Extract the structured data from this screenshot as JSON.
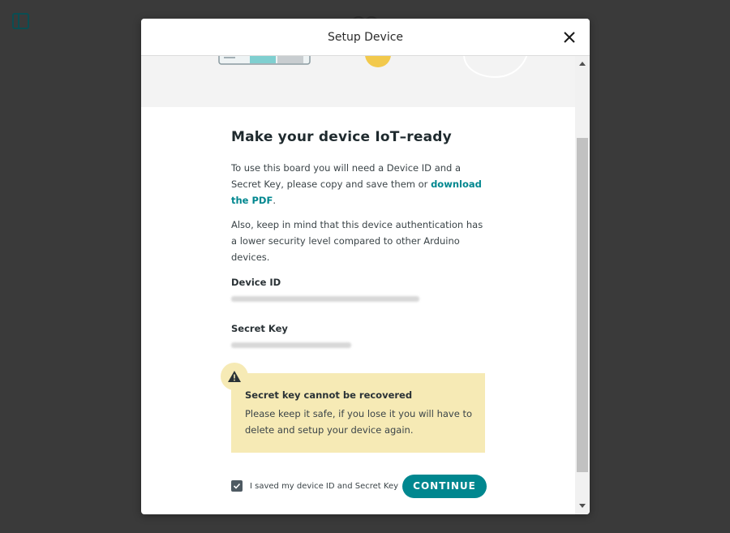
{
  "modal": {
    "title": "Setup Device"
  },
  "content": {
    "heading": "Make your device IoT–ready",
    "para1_prefix": "To use this board you will need a Device ID and a Secret Key, please copy and save them or ",
    "para1_link": "download the PDF",
    "para1_suffix": ".",
    "para2": "Also, keep in mind that this device authentication has a lower security level compared to other Arduino devices.",
    "device_id_label": "Device ID",
    "secret_key_label": "Secret Key"
  },
  "warning": {
    "title": "Secret key cannot be recovered",
    "text": "Please keep it safe, if you lose it you will have to delete and setup your device again."
  },
  "footer": {
    "checkbox_label": "I saved my device ID and Secret Key",
    "checkbox_checked": true,
    "continue_label": "CONTINUE"
  },
  "colors": {
    "accent": "#00878f",
    "warning_bg": "#f6eab5",
    "overlay": "#3a3a3a"
  },
  "icons": [
    "sidebar-toggle-icon",
    "close-icon",
    "warning-icon",
    "checkmark-icon",
    "scroll-up-icon",
    "scroll-down-icon"
  ]
}
